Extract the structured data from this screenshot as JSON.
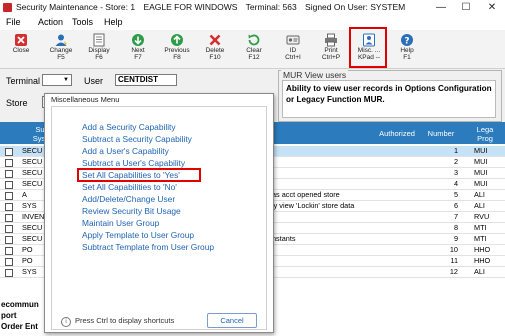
{
  "window": {
    "title_parts": [
      "Security Maintenance - Store: 1",
      "EAGLE FOR WINDOWS",
      "Terminal: 563",
      "Signed On User: SYSTEM"
    ],
    "minimize_glyph": "—",
    "maximize_glyph": "☐",
    "close_glyph": "✕"
  },
  "menu": [
    "File",
    "Action",
    "Tools",
    "Help"
  ],
  "toolbar": [
    {
      "label1": "Close",
      "label2": "",
      "icon": "close-icon",
      "color": "#d32f2f"
    },
    {
      "label1": "Change",
      "label2": "F5",
      "icon": "user-change-icon",
      "color": "#2b6fb8"
    },
    {
      "label1": "Display",
      "label2": "F6",
      "icon": "display-icon",
      "color": "#555555"
    },
    {
      "label1": "Next",
      "label2": "F7",
      "icon": "next-icon",
      "color": "#2e9d4a"
    },
    {
      "label1": "Previous",
      "label2": "F8",
      "icon": "previous-icon",
      "color": "#2e9d4a"
    },
    {
      "label1": "Delete",
      "label2": "F10",
      "icon": "delete-icon",
      "color": "#d32f2f"
    },
    {
      "label1": "Clear",
      "label2": "F12",
      "icon": "clear-icon",
      "color": "#2e9d4a"
    },
    {
      "label1": "ID",
      "label2": "Ctrl+I",
      "icon": "id-icon",
      "color": "#555555"
    },
    {
      "label1": "Print",
      "label2": "Ctrl+P",
      "icon": "print-icon",
      "color": "#555555"
    },
    {
      "label1": "Misc. ...",
      "label2": "KPad --",
      "icon": "misc-icon",
      "color": "#2b6fb8"
    },
    {
      "label1": "Help",
      "label2": "F1",
      "icon": "help-icon",
      "color": "#2b6fb8"
    }
  ],
  "filters": {
    "terminal_label": "Terminal",
    "terminal_value": "",
    "user_label": "User",
    "user_value": "CENTDIST",
    "store_label": "Store",
    "store_value": ""
  },
  "mur": {
    "title": "MUR View users",
    "text": "Ability to view user records in Options Configuration or Legacy Function MUR."
  },
  "grid": {
    "headers": {
      "col1": "Su\nSyst",
      "authorized": "Authorized",
      "number": "Number",
      "legacy": "Lega\nProg"
    },
    "rows": [
      {
        "sys": "SECU",
        "desc": "",
        "number": "1",
        "legacy": "MUI",
        "selected": true
      },
      {
        "sys": "SECU",
        "desc": "",
        "number": "2",
        "legacy": "MUI",
        "selected": false
      },
      {
        "sys": "SECU",
        "desc": "",
        "number": "3",
        "legacy": "MUI",
        "selected": false
      },
      {
        "sys": "SECU",
        "desc": "",
        "number": "4",
        "legacy": "MUI",
        "selected": false
      },
      {
        "sys": "A",
        "desc": "as acct opened store",
        "number": "5",
        "legacy": "ALI",
        "selected": false
      },
      {
        "sys": "SYS",
        "desc": "ly view 'Lockin' store data",
        "number": "6",
        "legacy": "ALI",
        "selected": false
      },
      {
        "sys": "INVENT",
        "desc": "",
        "number": "7",
        "legacy": "RVU",
        "selected": false
      },
      {
        "sys": "SECU",
        "desc": "",
        "number": "8",
        "legacy": "MTI",
        "selected": false
      },
      {
        "sys": "SECU",
        "desc": "nstants",
        "number": "9",
        "legacy": "MTI",
        "selected": false
      },
      {
        "sys": "PO",
        "desc": "",
        "number": "10",
        "legacy": "HHO",
        "selected": false
      },
      {
        "sys": "PO",
        "desc": "",
        "number": "11",
        "legacy": "HHO",
        "selected": false
      },
      {
        "sys": "SYS",
        "desc": "",
        "number": "12",
        "legacy": "ALI",
        "selected": false
      }
    ]
  },
  "bottom_links": [
    "ecommun",
    "port",
    "Order Ent"
  ],
  "dialog": {
    "title": "Miscellaneous Menu",
    "items": [
      "Add a Security Capability",
      "Subtract a Security Capability",
      "Add a User's Capability",
      "Subtract a User's Capability",
      "Set All Capabilities to 'Yes'",
      "Set All Capabilities to 'No'",
      "Add/Delete/Change User",
      "Review Security Bit Usage",
      "Maintain User Group",
      "Apply Template to User Group",
      "Subtract Template from User Group"
    ],
    "footer_text": "Press Ctrl to display shortcuts",
    "cancel_label": "Cancel"
  },
  "colors": {
    "accent": "#2b7bbd",
    "link": "#1f63b5",
    "highlight": "#e00000"
  }
}
